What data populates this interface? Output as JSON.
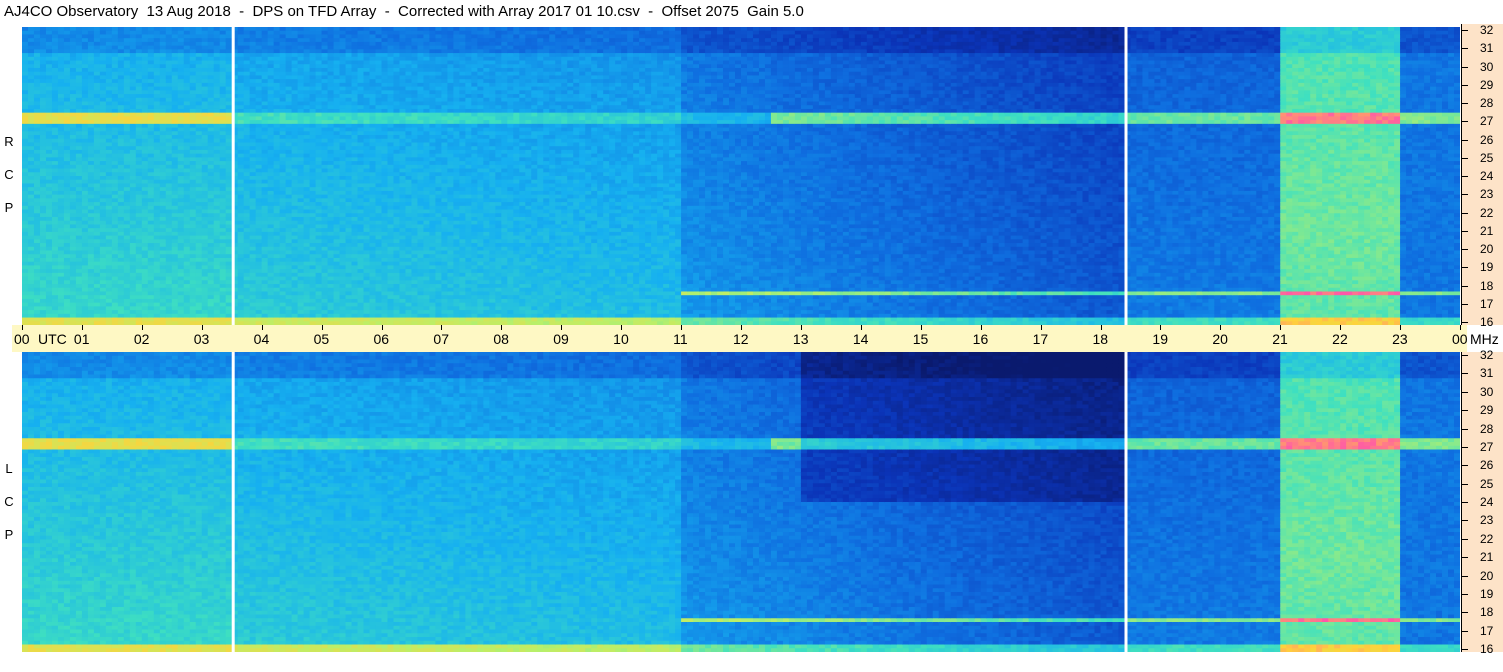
{
  "title": "AJ4CO Observatory  13 Aug 2018  -  DPS on TFD Array  -  Corrected with Array 2017 01 10.csv  -  Offset 2075  Gain 5.0",
  "chart_data": [
    {
      "type": "heatmap",
      "panel": "RCP",
      "ylabel": "R  C  P",
      "x_unit": "UTC",
      "y_unit": "MHz",
      "xlim": [
        0,
        24
      ],
      "ylim": [
        16,
        32
      ],
      "x_ticks": [
        "00",
        "01",
        "02",
        "03",
        "04",
        "05",
        "06",
        "07",
        "08",
        "09",
        "10",
        "11",
        "12",
        "13",
        "14",
        "15",
        "16",
        "17",
        "18",
        "19",
        "20",
        "21",
        "22",
        "23",
        "00"
      ],
      "y_ticks": [
        16,
        17,
        18,
        19,
        20,
        21,
        22,
        23,
        24,
        25,
        26,
        27,
        28,
        29,
        30,
        31,
        32
      ],
      "data_gaps_utc": [
        3.5,
        18.4
      ],
      "color_scale": [
        "#0a1a6e",
        "#0b34b8",
        "#0f6fe0",
        "#16b0f0",
        "#3fe0c0",
        "#b8f06a",
        "#ffd23a",
        "#ff4fb0"
      ]
    },
    {
      "type": "heatmap",
      "panel": "LCP",
      "ylabel": "L  C  P",
      "x_unit": "UTC",
      "y_unit": "MHz",
      "xlim": [
        0,
        24
      ],
      "ylim": [
        16,
        32
      ],
      "x_ticks": [
        "00",
        "01",
        "02",
        "03",
        "04",
        "05",
        "06",
        "07",
        "08",
        "09",
        "10",
        "11",
        "12",
        "13",
        "14",
        "15",
        "16",
        "17",
        "18",
        "19",
        "20",
        "21",
        "22",
        "23",
        "00"
      ],
      "y_ticks": [
        16,
        17,
        18,
        19,
        20,
        21,
        22,
        23,
        24,
        25,
        26,
        27,
        28,
        29,
        30,
        31,
        32
      ],
      "data_gaps_utc": [
        3.5,
        18.4
      ],
      "color_scale": [
        "#0a1a6e",
        "#0b34b8",
        "#0f6fe0",
        "#16b0f0",
        "#3fe0c0",
        "#b8f06a",
        "#ffd23a",
        "#ff4fb0"
      ]
    }
  ],
  "rcp_label": [
    "R",
    "C",
    "P"
  ],
  "lcp_label": [
    "L",
    "C",
    "P"
  ],
  "utc_label": "UTC",
  "mhz_label": "MHz"
}
